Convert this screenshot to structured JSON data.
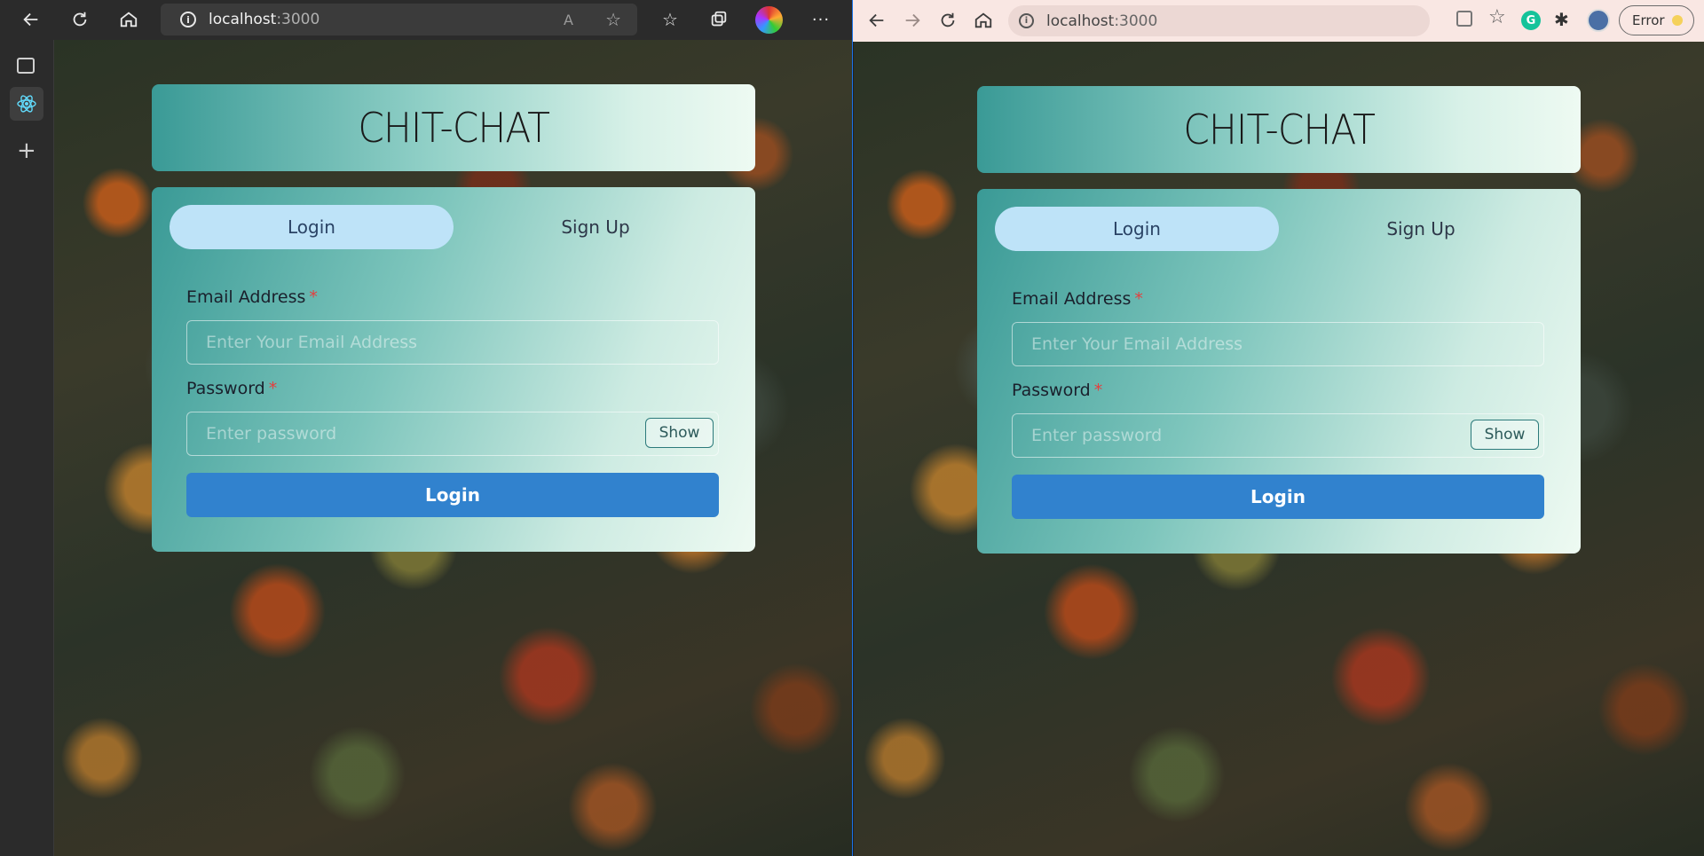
{
  "left_browser": {
    "url_host": "localhost",
    "url_port": ":3000"
  },
  "right_browser": {
    "url_host": "localhost",
    "url_port": ":3000",
    "error_label": "Error"
  },
  "app": {
    "brand": "CHIT-CHAT",
    "tabs": [
      {
        "label": "Login"
      },
      {
        "label": "Sign Up"
      }
    ],
    "email": {
      "label": "Email Address",
      "required_mark": "*",
      "placeholder": "Enter Your Email Address",
      "value": ""
    },
    "password": {
      "label": "Password",
      "required_mark": "*",
      "placeholder": "Enter password",
      "value": "",
      "toggle_label": "Show"
    },
    "submit_label": "Login"
  },
  "colors": {
    "login_button": "#3182ce",
    "active_tab": "#bee3f8",
    "required": "#e53e3e",
    "card_start": "#3a9a96",
    "card_end": "#eefaf2"
  }
}
